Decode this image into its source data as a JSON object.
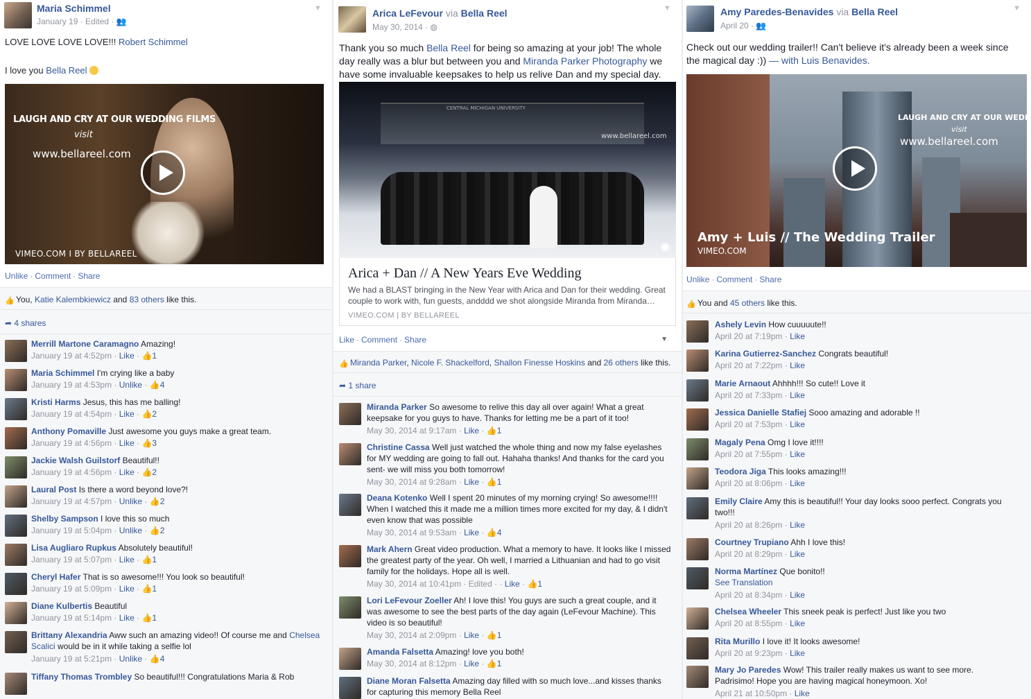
{
  "post1": {
    "author": "Maria Schimmel",
    "meta": "January 19 · Edited ·",
    "line1": "LOVE LOVE LOVE LOVE!!!",
    "tag1": "Robert Schimmel",
    "line2": "I love you",
    "tag2": "Bella Reel",
    "overlay_top": "LAUGH AND CRY AT OUR WEDDING FILMS",
    "overlay_visit": "visit",
    "overlay_url": "www.bellareel.com",
    "overlay_bottom": "VIMEO.COM  I  BY BELLAREEL",
    "actions": {
      "a": "Unlike",
      "b": "Comment",
      "c": "Share"
    },
    "likes_pre": "You,",
    "likes_name": "Katie Kalembkiewicz",
    "likes_and": "and",
    "likes_others": "83 others",
    "likes_post": "like this.",
    "shares": "4 shares",
    "comments": [
      {
        "name": "Merrill Martone Caramagno",
        "text": "Amazing!",
        "time": "January 19 at 4:52pm",
        "act": "Like",
        "count": "1"
      },
      {
        "name": "Maria Schimmel",
        "text": "I'm crying like a baby",
        "time": "January 19 at 4:53pm",
        "act": "Unlike",
        "count": "4"
      },
      {
        "name": "Kristi Harms",
        "text": "Jesus, this has me balling!",
        "time": "January 19 at 4:54pm",
        "act": "Like",
        "count": "2"
      },
      {
        "name": "Anthony Pomaville",
        "text": "Just awesome you guys make a great team.",
        "time": "January 19 at 4:56pm",
        "act": "Like",
        "count": "3"
      },
      {
        "name": "Jackie Walsh Guilstorf",
        "text": "Beautiful!!",
        "time": "January 19 at 4:56pm",
        "act": "Like",
        "count": "2"
      },
      {
        "name": "Laural Post",
        "text": "Is there a word beyond love?!",
        "time": "January 19 at 4:57pm",
        "act": "Unlike",
        "count": "2"
      },
      {
        "name": "Shelby Sampson",
        "text": "I love this so much",
        "time": "January 19 at 5:04pm",
        "act": "Unlike",
        "count": "2"
      },
      {
        "name": "Lisa Augliaro Rupkus",
        "text": "Absolutely beautiful!",
        "time": "January 19 at 5:07pm",
        "act": "Like",
        "count": "1"
      },
      {
        "name": "Cheryl Hafer",
        "text": "That is so awesome!!! You look so beautiful!",
        "time": "January 19 at 5:09pm",
        "act": "Like",
        "count": "1"
      },
      {
        "name": "Diane Kulbertis",
        "text": "Beautiful",
        "time": "January 19 at 5:14pm",
        "act": "Like",
        "count": "1"
      },
      {
        "name": "Brittany Alexandria",
        "text": "Aww such an amazing video!! Of course me and",
        "text_name": "Chelsea Scalici",
        "text2": "would be in it while taking a selfie lol",
        "time": "January 19 at 5:21pm",
        "act": "Unlike",
        "count": "4"
      },
      {
        "name": "Tiffany Thomas Trombley",
        "text": "So beautiful!!! Congratulations Maria & Rob"
      }
    ]
  },
  "post2": {
    "author": "Arica LeFevour",
    "via": "via",
    "page": "Bella Reel",
    "meta": "May 30, 2014 ·",
    "t1": "Thank you so much",
    "t1name": "Bella Reel",
    "t2": "for being so amazing at your job! The whole day really was a blur but between you and",
    "t2name": "Miranda Parker Photography",
    "t3": "we have some invaluable keepsakes to help us relive Dan and my special day.",
    "img_watermark": "www.bellareel.com",
    "img_sign": "CENTRAL MICHIGAN UNIVERSITY",
    "card_title": "Arica + Dan // A New Years Eve Wedding",
    "card_desc": "We had a BLAST bringing in the New Year with Arica and Dan for their wedding. Great couple to work with, fun guests, andddd we shot alongside Miranda from Miranda…",
    "card_src": "VIMEO.COM  |  BY BELLAREEL",
    "actions": {
      "a": "Like",
      "b": "Comment",
      "c": "Share"
    },
    "likes_n1": "Miranda Parker",
    "likes_n2": "Nicole F. Shackelford",
    "likes_n3": "Shallon Finesse Hoskins",
    "likes_and": "and",
    "likes_others": "26 others",
    "likes_post": "like this.",
    "shares": "1 share",
    "comments": [
      {
        "name": "Miranda Parker",
        "text": "So awesome to relive this day all over again! What a great keepsake for you guys to have. Thanks for letting me be a part of it too!",
        "time": "May 30, 2014 at 9:17am",
        "act": "Like",
        "count": "1"
      },
      {
        "name": "Christine Cassa",
        "text": "Well just watched the whole thing and now my false eyelashes for MY wedding are going to fall out. Hahaha thanks! And thanks for the card you sent- we will miss you both tomorrow!",
        "time": "May 30, 2014 at 9:28am",
        "act": "Like",
        "count": "1"
      },
      {
        "name": "Deana Kotenko",
        "text": "Well I spent 20 minutes of my morning crying! So awesome!!!! When I watched this it made me a million times more excited for my day, & I didn't even know that was possible",
        "time": "May 30, 2014 at 9:53am",
        "act": "Like",
        "count": "4"
      },
      {
        "name": "Mark Ahern",
        "text": "Great video production. What a memory to have. It looks like I missed the greatest party of the year. Oh well, I married a Lithuanian and had to go visit family for the holidays. Hope all is well.",
        "time": "May 30, 2014 at 10:41pm · Edited ·",
        "act": "Like",
        "count": "1"
      },
      {
        "name": "Lori LeFevour Zoeller",
        "text": "Ah! I love this! You guys are such a great couple, and it was awesome to see the best parts of the day again (LeFevour Machine). This video is so beautiful!",
        "time": "May 30, 2014 at 2:09pm",
        "act": "Like",
        "count": "1"
      },
      {
        "name": "Amanda Falsetta",
        "text": "Amazing!",
        "text2": "love you both!",
        "time": "May 30, 2014 at 8:12pm",
        "act": "Like",
        "count": "1"
      },
      {
        "name": "Diane Moran Falsetta",
        "text": "Amazing day filled with so much love...and kisses",
        "text2": "thanks for capturing this memory Bella Reel"
      }
    ]
  },
  "post3": {
    "author": "Amy Paredes-Benavides",
    "via": "via",
    "page": "Bella Reel",
    "meta": "April 20 ·",
    "t1": "Check out our wedding trailer!! Can't believe it's already been a week since the magical day :))",
    "t1with": "— with",
    "t1name": "Luis Benavides.",
    "overlay_top": "LAUGH AND CRY AT OUR WEDDING FILMS",
    "overlay_visit": "visit",
    "overlay_url": "www.bellareel.com",
    "overlay_title": "Amy + Luis // The Wedding Trailer",
    "overlay_src": "VIMEO.COM",
    "actions": {
      "a": "Unlike",
      "b": "Comment",
      "c": "Share"
    },
    "likes_pre": "You and",
    "likes_others": "45 others",
    "likes_post": "like this.",
    "comments": [
      {
        "name": "Ashely Levin",
        "text": "How cuuuuute!!",
        "time": "April 20 at 7:19pm",
        "act": "Like"
      },
      {
        "name": "Karina Gutierrez-Sanchez",
        "text": "Congrats beautiful!",
        "time": "April 20 at 7:22pm",
        "act": "Like"
      },
      {
        "name": "Marie Arnaout",
        "text": "Ahhhh!!! So cute!! Love it",
        "time": "April 20 at 7:33pm",
        "act": "Like"
      },
      {
        "name": "Jessica Danielle Stafiej",
        "text": "Sooo amazing and adorable !!",
        "time": "April 20 at 7:53pm",
        "act": "Like"
      },
      {
        "name": "Magaly Pena",
        "text": "Omg I love it!!!!",
        "time": "April 20 at 7:55pm",
        "act": "Like"
      },
      {
        "name": "Teodora Jiga",
        "text": "This looks amazing!!!",
        "time": "April 20 at 8:06pm",
        "act": "Like"
      },
      {
        "name": "Emily Claire",
        "text": "Amy this is beautiful!! Your day looks sooo perfect. Congrats you two!!!",
        "time": "April 20 at 8:26pm",
        "act": "Like"
      },
      {
        "name": "Courtney Trupiano",
        "text": "Ahh I love this!",
        "time": "April 20 at 8:29pm",
        "act": "Like"
      },
      {
        "name": "Norma Martínez",
        "text": "Que bonito!!",
        "text2": "See Translation",
        "time": "April 20 at 8:34pm",
        "act": "Like"
      },
      {
        "name": "Chelsea Wheeler",
        "text": "This sneek peak is perfect! Just like you two",
        "time": "April 20 at 8:55pm",
        "act": "Like"
      },
      {
        "name": "Rita Murillo",
        "text": "I love it! It looks awesome!",
        "time": "April 20 at 9:23pm",
        "act": "Like"
      },
      {
        "name": "Mary Jo Paredes",
        "text": "Wow! This trailer really makes us want to see more. Padrisimo! Hope you are having magical honeymoon. Xo!",
        "time": "April 21 at 10:50pm",
        "act": "Like"
      }
    ]
  }
}
